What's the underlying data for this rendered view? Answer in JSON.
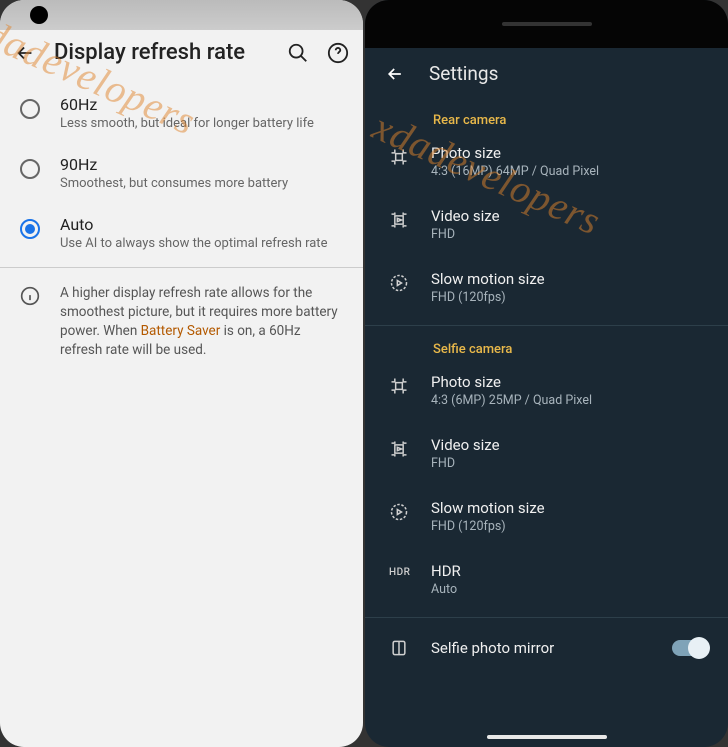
{
  "left": {
    "statusbar_time": "",
    "title": "Display refresh rate",
    "options": [
      {
        "title": "60Hz",
        "desc": "Less smooth, but ideal for longer battery life",
        "selected": false
      },
      {
        "title": "90Hz",
        "desc": "Smoothest, but consumes more battery",
        "selected": false
      },
      {
        "title": "Auto",
        "desc": "Use AI to always show the optimal refresh rate",
        "selected": true
      }
    ],
    "info_pre": "A higher display refresh rate allows for the smoothest picture, but it requires more battery power. When ",
    "info_link": "Battery Saver",
    "info_post": " is on, a 60Hz refresh rate will be used."
  },
  "right": {
    "title": "Settings",
    "sections": [
      {
        "label": "Rear camera",
        "items": [
          {
            "title": "Photo size",
            "value": "4:3 (16MP) 64MP / Quad Pixel"
          },
          {
            "title": "Video size",
            "value": "FHD"
          },
          {
            "title": "Slow motion size",
            "value": "FHD (120fps)"
          }
        ]
      },
      {
        "label": "Selfie camera",
        "items": [
          {
            "title": "Photo size",
            "value": "4:3 (6MP) 25MP / Quad Pixel"
          },
          {
            "title": "Video size",
            "value": "FHD"
          },
          {
            "title": "Slow motion size",
            "value": "FHD (120fps)"
          }
        ]
      }
    ],
    "hdr": {
      "title": "HDR",
      "value": "Auto"
    },
    "mirror": {
      "title": "Selfie photo mirror",
      "on": true
    }
  },
  "watermark": "xdadevelopers"
}
